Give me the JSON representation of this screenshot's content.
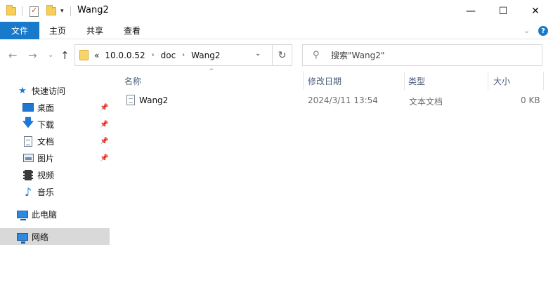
{
  "window": {
    "title": "Wang2",
    "minimize_glyph": "—",
    "maximize_glyph": "☐",
    "close_glyph": "✕"
  },
  "ribbon": {
    "tabs": [
      "文件",
      "主页",
      "共享",
      "查看"
    ],
    "help_glyph": "?",
    "expand_glyph": "⌄"
  },
  "nav": {
    "back_glyph": "←",
    "forward_glyph": "→",
    "recent_glyph": "⌄",
    "up_glyph": "↑",
    "breadcrumb_prefix": "«",
    "breadcrumb": [
      "10.0.0.52",
      "doc",
      "Wang2"
    ],
    "breadcrumb_sep": "›",
    "refresh_glyph": "↻",
    "search_placeholder": "搜索\"Wang2\"",
    "search_glyph": "⚲"
  },
  "sidebar": {
    "quick_access": "快速访问",
    "items": [
      {
        "label": "桌面",
        "icon": "desktop-icon",
        "pinned": true
      },
      {
        "label": "下载",
        "icon": "download-icon",
        "pinned": true
      },
      {
        "label": "文档",
        "icon": "documents-icon",
        "pinned": true
      },
      {
        "label": "图片",
        "icon": "pictures-icon",
        "pinned": true
      },
      {
        "label": "视频",
        "icon": "videos-icon",
        "pinned": false
      },
      {
        "label": "音乐",
        "icon": "music-icon",
        "pinned": false
      }
    ],
    "this_pc": "此电脑",
    "network": "网络",
    "pin_glyph": "📌"
  },
  "content": {
    "columns": {
      "name": "名称",
      "modified": "修改日期",
      "type": "类型",
      "size": "大小"
    },
    "sort_glyph": "^",
    "files": [
      {
        "name": "Wang2",
        "modified": "2024/3/11 13:54",
        "type": "文本文档",
        "size": "0 KB"
      }
    ]
  },
  "colors": {
    "accent": "#1979ca",
    "selected_bg": "#d9d9d9",
    "header_text": "#4c607a"
  }
}
